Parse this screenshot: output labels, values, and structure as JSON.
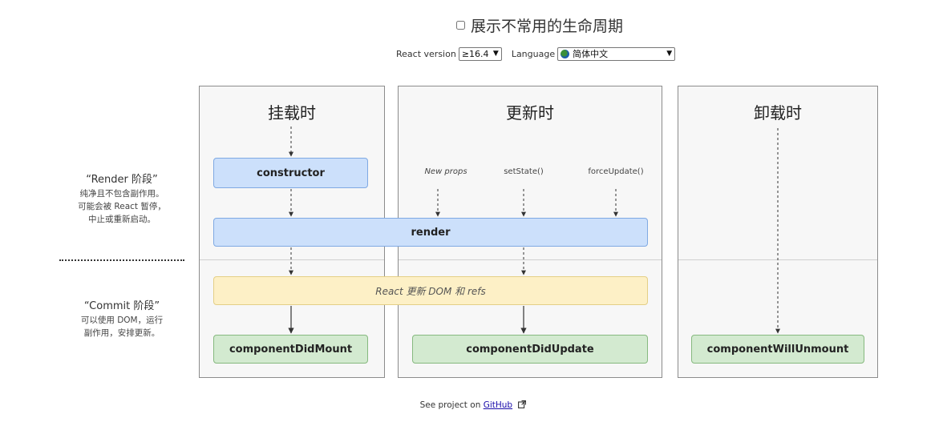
{
  "header": {
    "title": "展示不常用的生命周期",
    "react_version_label": "React version",
    "react_version_value": "≥16.4",
    "language_label": "Language",
    "language_value": "简体中文"
  },
  "phases": {
    "render": {
      "title": "“Render 阶段”",
      "lines": [
        "纯净且不包含副作用。",
        "可能会被 React 暂停，",
        "中止或重新启动。"
      ]
    },
    "commit": {
      "title": "“Commit 阶段”",
      "lines": [
        "可以使用 DOM，运行",
        "副作用，安排更新。"
      ]
    }
  },
  "columns": {
    "mount": {
      "title": "挂载时"
    },
    "update": {
      "title": "更新时"
    },
    "unmount": {
      "title": "卸载时"
    }
  },
  "triggers": {
    "new_props": "New props",
    "set_state": "setState()",
    "force_update": "forceUpdate()"
  },
  "boxes": {
    "constructor": "constructor",
    "render": "render",
    "react_updates_dom": "React 更新 DOM 和 refs",
    "component_did_mount": "componentDidMount",
    "component_did_update": "componentDidUpdate",
    "component_will_unmount": "componentWillUnmount"
  },
  "footer": {
    "prefix": "See project on ",
    "link_text": "GitHub",
    "external_icon": "external-link-icon"
  },
  "colors": {
    "blue_box": "#cce0fb",
    "green_box": "#d3ead0",
    "yellow_box": "#fdf0c6"
  }
}
